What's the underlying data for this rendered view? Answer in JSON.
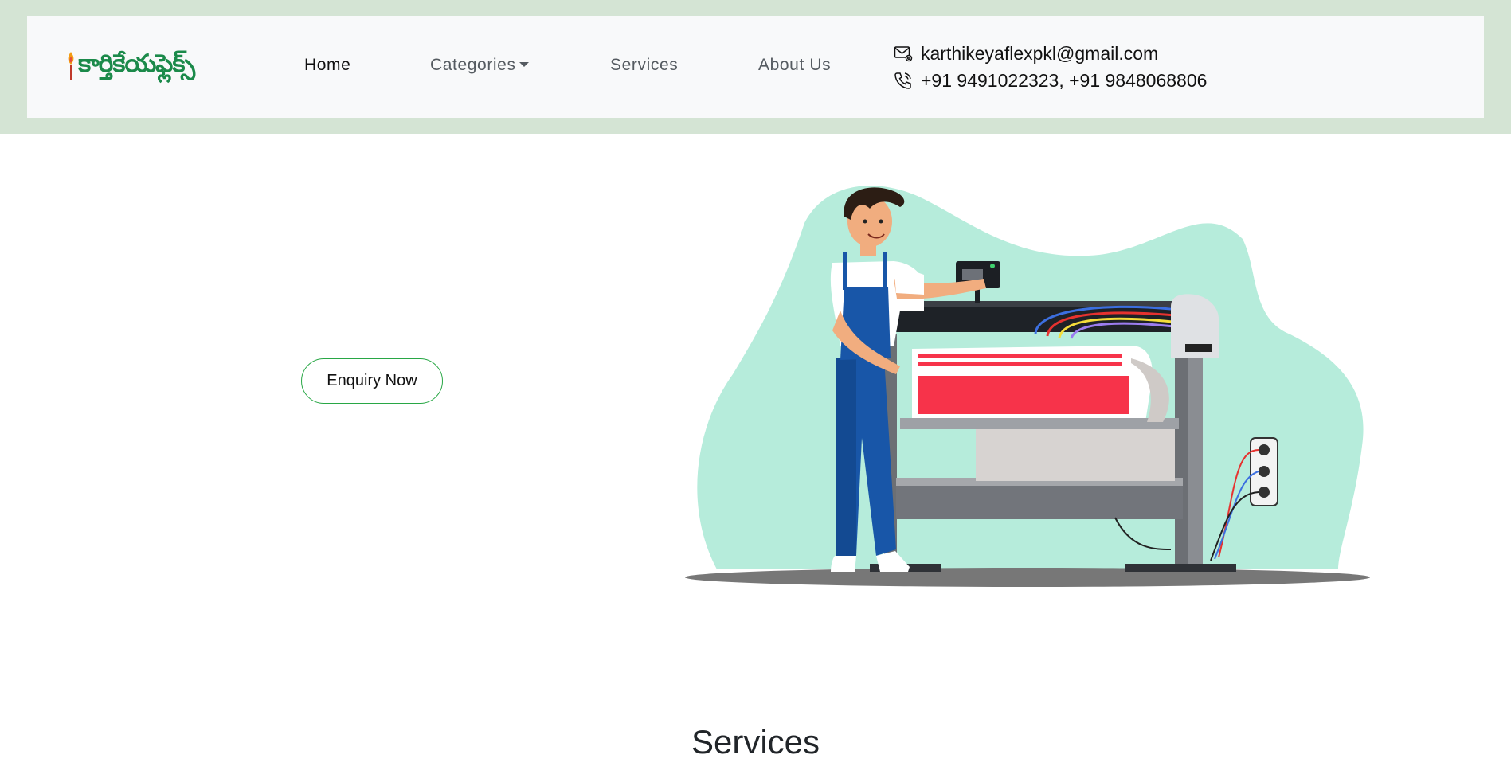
{
  "brand": {
    "logo_text": "కార్తికేయఫ్లెక్స్"
  },
  "nav": {
    "items": [
      {
        "label": "Home",
        "active": true
      },
      {
        "label": "Categories",
        "dropdown": true
      },
      {
        "label": "Services"
      },
      {
        "label": "About Us"
      }
    ]
  },
  "contact": {
    "email": "karthikeyaflexpkl@gmail.com",
    "phone": "+91 9491022323, +91 9848068806",
    "email_icon": "envelope-at-icon",
    "phone_icon": "phone-icon"
  },
  "hero": {
    "button_label": "Enquiry Now",
    "illustration": "man-operating-large-format-printer"
  },
  "services": {
    "title": "Services"
  },
  "colors": {
    "band": "#d4e4d4",
    "navbar": "#f8f9fa",
    "brand_green": "#1b8a4a",
    "button_border": "#28a745",
    "blob": "#b6ecdb",
    "printer_red": "#f7334a"
  }
}
